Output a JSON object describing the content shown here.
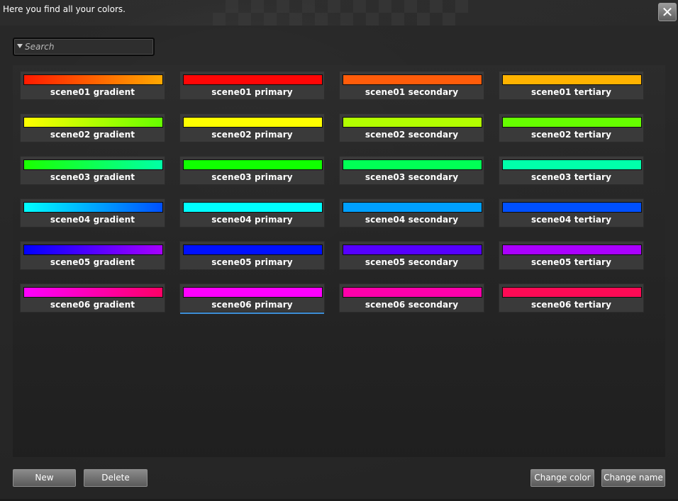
{
  "window": {
    "title": "Here you find all your colors.",
    "close_glyph": "✕"
  },
  "search": {
    "placeholder": "Search",
    "value": ""
  },
  "colors": [
    {
      "name": "scene01 gradient",
      "fill": "linear-gradient(90deg,#ff1a00,#ffa800)"
    },
    {
      "name": "scene01 primary",
      "fill": "#ff0606"
    },
    {
      "name": "scene01 secondary",
      "fill": "#ff5c0a"
    },
    {
      "name": "scene01 tertiary",
      "fill": "#ffb300"
    },
    {
      "name": "scene02 gradient",
      "fill": "linear-gradient(90deg,#ffff00,#66ff00)"
    },
    {
      "name": "scene02 primary",
      "fill": "#ffff00"
    },
    {
      "name": "scene02 secondary",
      "fill": "#b2ff00"
    },
    {
      "name": "scene02 tertiary",
      "fill": "#66ff00"
    },
    {
      "name": "scene03 gradient",
      "fill": "linear-gradient(90deg,#1aff00,#00ffa6)"
    },
    {
      "name": "scene03 primary",
      "fill": "#10ff00"
    },
    {
      "name": "scene03 secondary",
      "fill": "#00ff55"
    },
    {
      "name": "scene03 tertiary",
      "fill": "#00ffaa"
    },
    {
      "name": "scene04 gradient",
      "fill": "linear-gradient(90deg,#00ffff,#0050ff)"
    },
    {
      "name": "scene04 primary",
      "fill": "#00ffff"
    },
    {
      "name": "scene04 secondary",
      "fill": "#00a0ff"
    },
    {
      "name": "scene04 tertiary",
      "fill": "#0050ff"
    },
    {
      "name": "scene05 gradient",
      "fill": "linear-gradient(90deg,#0000ff,#a600ff)"
    },
    {
      "name": "scene05 primary",
      "fill": "#0010ff"
    },
    {
      "name": "scene05 secondary",
      "fill": "#5500ff"
    },
    {
      "name": "scene05 tertiary",
      "fill": "#aa00ff"
    },
    {
      "name": "scene06 gradient",
      "fill": "linear-gradient(90deg,#ff00ff,#ff0066)"
    },
    {
      "name": "scene06 primary",
      "fill": "#ff00ff"
    },
    {
      "name": "scene06 secondary",
      "fill": "#ff00aa"
    },
    {
      "name": "scene06 tertiary",
      "fill": "#ff0a55"
    }
  ],
  "selected_color": "scene06 primary",
  "buttons": {
    "new": "New",
    "delete": "Delete",
    "change_color": "Change color",
    "change_name": "Change name"
  }
}
